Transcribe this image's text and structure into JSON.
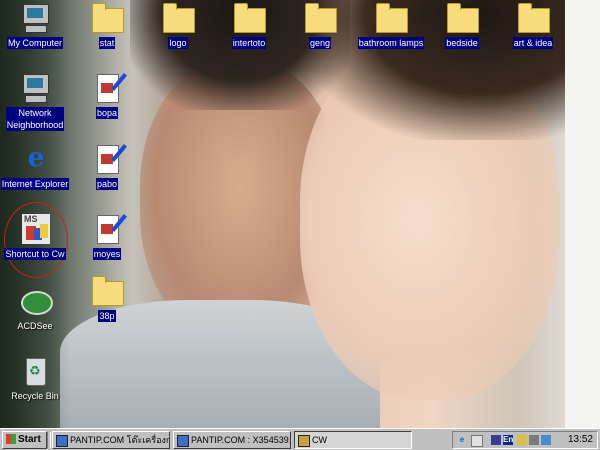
{
  "desktop": {
    "icons": [
      {
        "label": "My Computer",
        "icon": "computer-icon"
      },
      {
        "label": "Network Neighborhood",
        "line1": "Network",
        "line2": "Neighborhood",
        "icon": "network-icon"
      },
      {
        "label": "Internet Explorer",
        "icon": "internet-explorer-icon"
      },
      {
        "label": "Shortcut to Cw",
        "icon": "ms-shortcut-icon"
      },
      {
        "label": "ACDSee",
        "icon": "acdsee-icon"
      },
      {
        "label": "Recycle Bin",
        "icon": "recycle-bin-icon"
      },
      {
        "label": "stat",
        "icon": "folder-icon"
      },
      {
        "label": "bopa",
        "icon": "document-icon"
      },
      {
        "label": "pabo",
        "icon": "document-icon"
      },
      {
        "label": "moyes",
        "icon": "document-icon"
      },
      {
        "label": "38p",
        "icon": "folder-icon"
      },
      {
        "label": "logo",
        "icon": "folder-icon"
      },
      {
        "label": "intertoto",
        "icon": "folder-icon"
      },
      {
        "label": "geng",
        "icon": "folder-icon"
      },
      {
        "label": "bathroom lamps",
        "icon": "folder-icon"
      },
      {
        "label": "bedside",
        "icon": "folder-icon"
      },
      {
        "label": "art & idea",
        "icon": "folder-icon"
      }
    ],
    "ms_icon_text": "MS"
  },
  "taskbar": {
    "start_label": "Start",
    "tasks": [
      {
        "label": "PANTIP.COM โต๊ะเครื่องกล : ..."
      },
      {
        "label": "PANTIP.COM : X3545391 ..."
      },
      {
        "label": "CW"
      }
    ],
    "tray_lang": "En",
    "clock": "13:52"
  }
}
